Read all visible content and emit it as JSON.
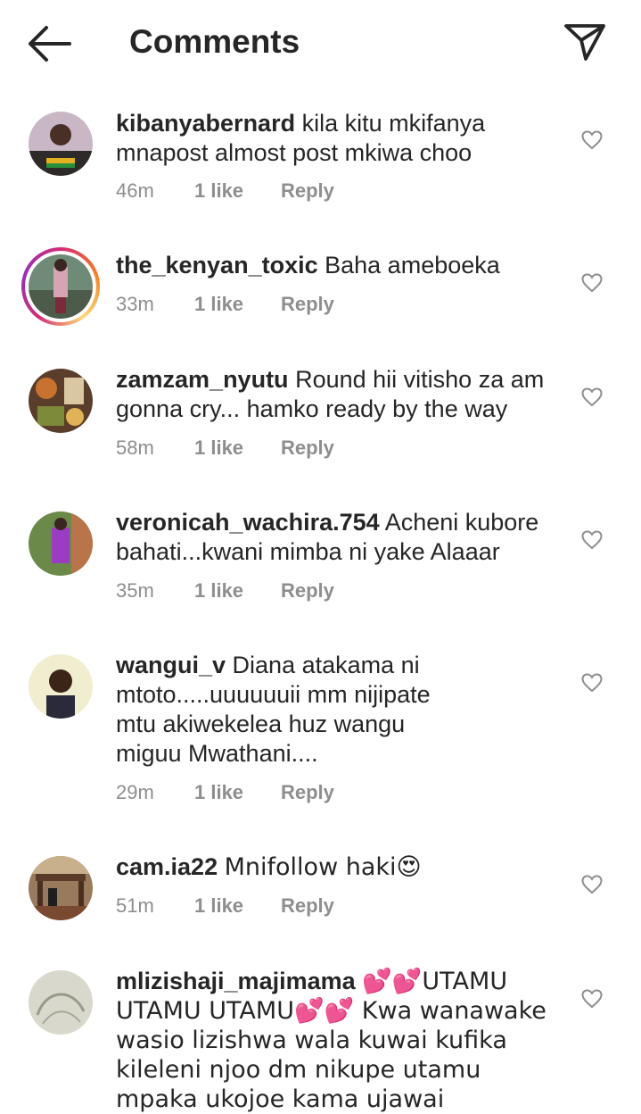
{
  "header": {
    "title": "Comments"
  },
  "colors": {
    "text": "#262626",
    "meta": "#8e8e8e",
    "background": "#ffffff"
  },
  "icons": {
    "back": "arrow-left-icon",
    "share": "paper-plane-icon",
    "like": "heart-outline-icon"
  },
  "comments": [
    {
      "username": "kibanyabernard",
      "text": "kila kitu mkifanya mnapost almost post mkiwa choo",
      "time": "46m",
      "likes": "1 like",
      "reply": "Reply"
    },
    {
      "username": "the_kenyan_toxic",
      "text": "Baha ameboeka",
      "time": "33m",
      "likes": "1 like",
      "reply": "Reply"
    },
    {
      "username": "zamzam_nyutu",
      "text": "Round hii vitisho za am gonna cry... hamko ready by the way",
      "time": "58m",
      "likes": "1 like",
      "reply": "Reply"
    },
    {
      "username": "veronicah_wachira.754",
      "text": "Acheni kubore bahati...kwani mimba ni yake Alaaar",
      "time": "35m",
      "likes": "1 like",
      "reply": "Reply"
    },
    {
      "username": "wangui_v",
      "text": "Diana atakama ni mtoto.....uuuuuuii mm nijipate mtu akiwekelea huz wangu miguu Mwathani....",
      "time": "29m",
      "likes": "1 like",
      "reply": "Reply"
    },
    {
      "username": "cam.ia22",
      "text": "Mnifollow haki😍",
      "time": "51m",
      "likes": "1 like",
      "reply": "Reply"
    },
    {
      "username": "mlizishaji_majimama",
      "text": "💕💕UTAMU UTAMU UTAMU💕💕 Kwa wanawake wasio lizishwa wala kuwai kufika kileleni njoo dm nikupe utamu mpaka ukojoe kama ujawai",
      "time": "",
      "likes": "",
      "reply": ""
    }
  ]
}
